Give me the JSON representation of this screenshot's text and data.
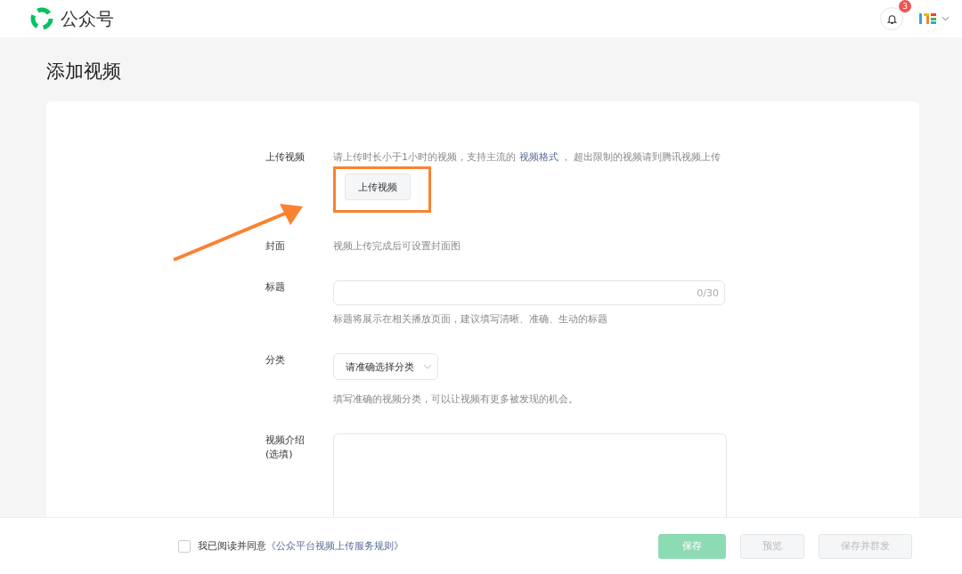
{
  "header": {
    "app_name": "公众号",
    "notification_count": "3"
  },
  "page_title": "添加视频",
  "form": [
    {
      "kind": "upload",
      "label": "上传视频",
      "hint_before": "请上传时长小于1小时的视频，支持主流的 ",
      "hint_link": "视频格式",
      "hint_after": " ， 超出限制的视频请到腾讯视频上传",
      "button": "上传视频"
    },
    {
      "kind": "note",
      "label": "封面",
      "text": "视频上传完成后可设置封面图"
    },
    {
      "kind": "input",
      "label": "标题",
      "counter": "0/30",
      "hint": "标题将展示在相关播放页面，建议填写清晰、准确、生动的标题"
    },
    {
      "kind": "select",
      "label": "分类",
      "placeholder": "请准确选择分类",
      "hint": "填写准确的视频分类，可以让视频有更多被发现的机会。"
    },
    {
      "kind": "textarea",
      "label": "视频介绍",
      "label_note": "(选填)"
    }
  ],
  "footer": {
    "agree_checked": false,
    "agree_text": "我已阅读并同意",
    "agree_link": "《公众平台视频上传服务规则》",
    "buttons": [
      {
        "label": "保存",
        "kind": "primary",
        "disabled": true
      },
      {
        "label": "预览",
        "kind": "default",
        "disabled": true
      },
      {
        "label": "保存并群发",
        "kind": "default",
        "disabled": true
      }
    ]
  }
}
